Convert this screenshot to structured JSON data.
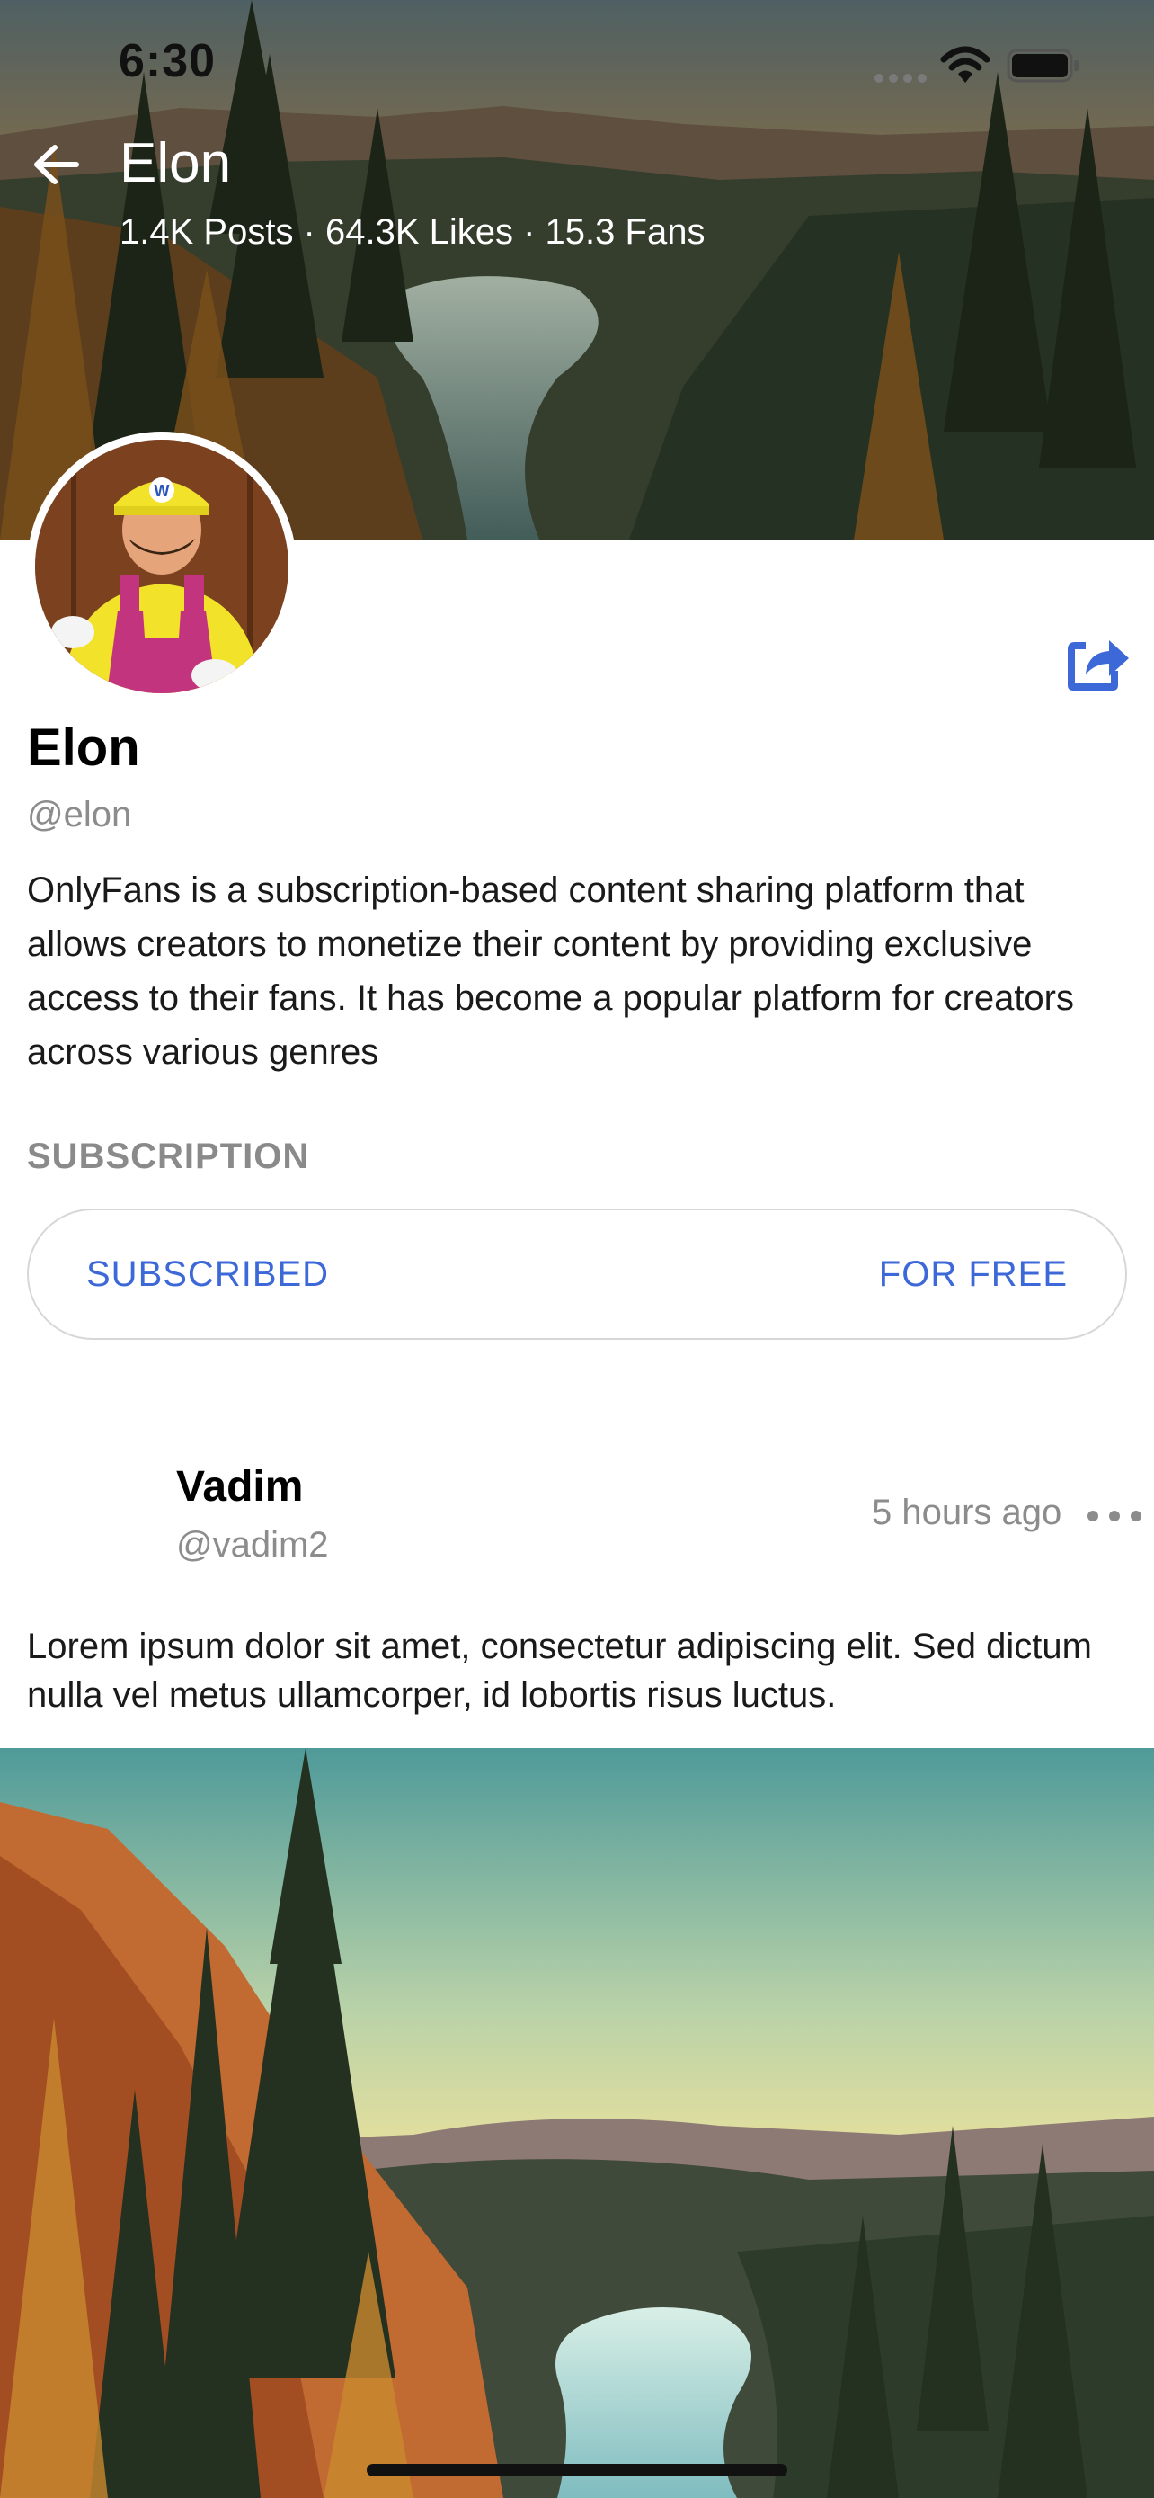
{
  "status_bar": {
    "time": "6:30"
  },
  "header": {
    "title": "Elon",
    "stats": "1.4K Posts · 64.3K Likes · 15.3 Fans"
  },
  "profile": {
    "name": "Elon",
    "handle": "@elon",
    "bio": "OnlyFans is a subscription-based content sharing platform that allows creators to monetize their content by providing exclusive access to their fans. It has become a popular platform for creators across various genres"
  },
  "subscription": {
    "heading": "SUBSCRIPTION",
    "status": "SUBSCRIBED",
    "price": "FOR FREE"
  },
  "post": {
    "author": "Vadim",
    "handle": "@vadim2",
    "time": "5 hours ago",
    "text": "Lorem ipsum dolor sit amet, consectetur adipiscing elit. Sed dictum nulla vel metus ullamcorper, id lobortis risus luctus."
  },
  "icons": {
    "back": "arrow-left-icon",
    "share": "share-icon",
    "more": "more-horizontal-icon",
    "wifi": "wifi-icon",
    "battery": "battery-icon",
    "signal": "cellular-signal-icon"
  },
  "colors": {
    "accent": "#3d68d8",
    "muted_text": "#8c8c8c",
    "border": "#d7d7d7"
  }
}
